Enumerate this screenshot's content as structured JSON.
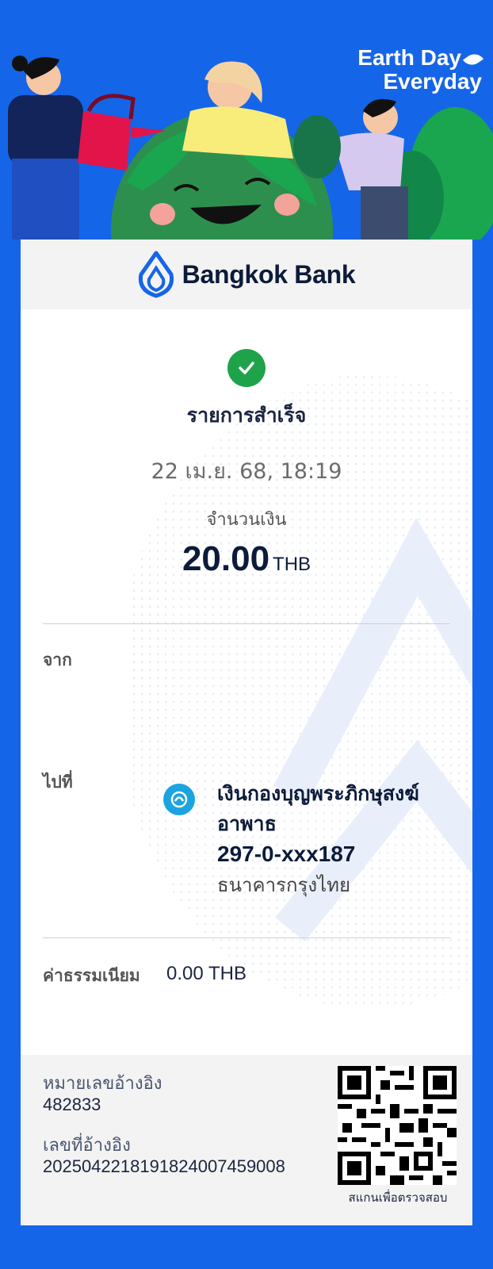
{
  "banner": {
    "campaign_line1": "Earth Day",
    "campaign_line2": "Everyday"
  },
  "bank": {
    "name": "Bangkok Bank",
    "brand_color": "#1565e8"
  },
  "status": {
    "icon": "check-icon",
    "text": "รายการสำเร็จ",
    "color": "#1fa34a"
  },
  "transaction": {
    "datetime": "22 เม.ย. 68, 18:19",
    "amount_label": "จำนวนเงิน",
    "amount": "20.00",
    "currency": "THB"
  },
  "from": {
    "label": "จาก"
  },
  "to": {
    "label": "ไปที่",
    "bank_icon": "krungthai-bank-icon",
    "name": "เงินกองบุญพระภิกษุสงฆ์อาพาธ",
    "account": "297-0-xxx187",
    "bank": "ธนาคารกรุงไทย"
  },
  "fee": {
    "label": "ค่าธรรมเนียม",
    "value": "0.00 THB"
  },
  "reference": {
    "ref_label": "หมายเลขอ้างอิง",
    "ref_value": "482833",
    "ref_no_label": "เลขที่อ้างอิง",
    "ref_no_value": "20250422181918240074590​08",
    "qr_caption": "สแกนเพื่อตรวจสอบ"
  }
}
